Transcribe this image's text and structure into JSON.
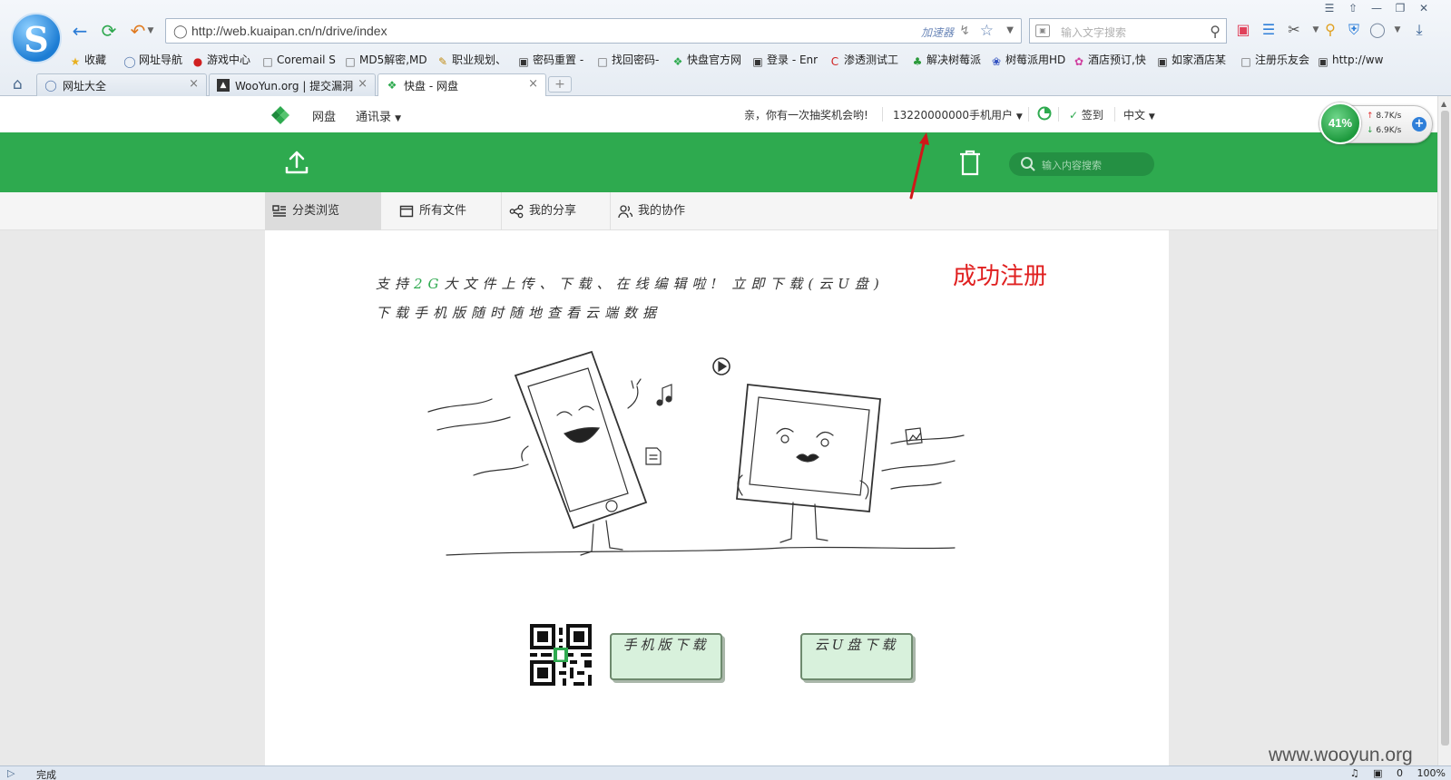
{
  "browser": {
    "url": "http://web.kuaipan.cn/n/drive/index",
    "accelerator": "加速器",
    "search_placeholder": "输入文字搜索",
    "bookmarks": [
      {
        "label": "收藏",
        "icon": "star-icon"
      },
      {
        "label": "网址导航",
        "icon": "globe-icon"
      },
      {
        "label": "游戏中心",
        "icon": "game-icon"
      },
      {
        "label": "Coremail S",
        "icon": "page-icon"
      },
      {
        "label": "MD5解密,MD",
        "icon": "page-icon"
      },
      {
        "label": "职业规划、",
        "icon": "pencil-icon"
      },
      {
        "label": "密码重置 -",
        "icon": "image-icon"
      },
      {
        "label": "找回密码-",
        "icon": "page-icon"
      },
      {
        "label": "快盘官方网",
        "icon": "kuaipan-icon"
      },
      {
        "label": "登录 - Enr",
        "icon": "image-icon"
      },
      {
        "label": "渗透测试工",
        "icon": "c-icon"
      },
      {
        "label": "解决树莓派",
        "icon": "plant-icon"
      },
      {
        "label": "树莓派用HD",
        "icon": "paw-icon"
      },
      {
        "label": "酒店预订,快",
        "icon": "flower-icon"
      },
      {
        "label": "如家酒店某",
        "icon": "image-icon"
      },
      {
        "label": "注册乐友会",
        "icon": "page-icon"
      },
      {
        "label": "http://ww",
        "icon": "image-icon"
      }
    ],
    "tabs": [
      {
        "label": "网址大全",
        "icon": "globe-icon",
        "active": false
      },
      {
        "label": "WooYun.org | 提交漏洞",
        "icon": "wooyun-icon",
        "active": false
      },
      {
        "label": "快盘 - 网盘",
        "icon": "kuaipan-icon",
        "active": true
      }
    ],
    "status_text": "完成",
    "status_right": {
      "count": "0",
      "zoom": "100%"
    }
  },
  "kuaipan": {
    "nav": {
      "drive": "网盘",
      "contacts": "通讯录"
    },
    "lottery": "亲，你有一次抽奖机会哟!",
    "user": "13220000000手机用户",
    "checkin": "签到",
    "language": "中文",
    "search_placeholder": "输入内容搜索",
    "tabs": [
      {
        "label": "分类浏览",
        "icon": "category-icon",
        "active": true
      },
      {
        "label": "所有文件",
        "icon": "folder-icon",
        "active": false
      },
      {
        "label": "我的分享",
        "icon": "share-icon",
        "active": false
      },
      {
        "label": "我的协作",
        "icon": "collab-icon",
        "active": false
      }
    ],
    "promo_line1_a": "支持",
    "promo_line1_b": "2G",
    "promo_line1_c": "大文件上传、下载、在线编辑啦! 立即下载(云U盘)",
    "promo_line2": "下载手机版随时随地查看云端数据",
    "success_note": "成功注册",
    "btn_mobile": "手机版下载",
    "btn_upan": "云U盘下载",
    "brand_green": "#2eaa4f"
  },
  "speed_widget": {
    "percent": "41%",
    "up": "8.7K/s",
    "down": "6.9K/s"
  },
  "watermark": "www.wooyun.org"
}
